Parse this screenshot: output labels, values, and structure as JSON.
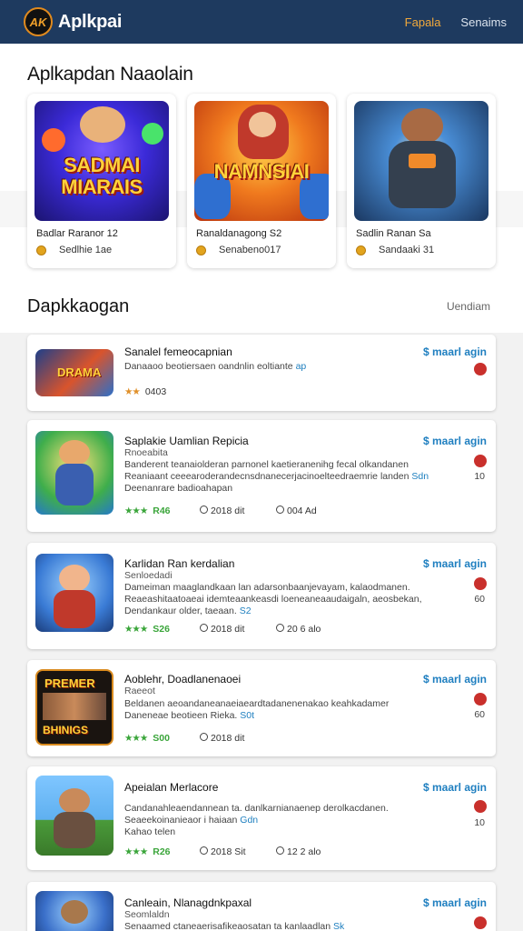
{
  "header": {
    "logo_text": "AK",
    "brand": "Aplkpai",
    "nav": [
      {
        "label": "Fapala",
        "active": true
      },
      {
        "label": "Senaims",
        "active": false
      }
    ]
  },
  "featured": {
    "title": "Aplkapdan Naaolain",
    "cards": [
      {
        "image_text": "SADMAI MIARAIS",
        "name": "Badlar Raranor 12",
        "meta": "Sedlhie 1ae"
      },
      {
        "image_text": "NAMNSIAI",
        "name": "Ranaldanagong S2",
        "meta": "Senabeno017"
      },
      {
        "image_text": "",
        "name": "Sadlin Ranan Sa",
        "meta": "Sandaaki 31"
      }
    ]
  },
  "downloads": {
    "title": "Dapkkaogan",
    "link": "Uendiam",
    "items": [
      {
        "title": "Sanalel femeocapnian",
        "subtitle": "",
        "desc": [
          "Danaaoo beotiersaen oandnlin eoltiante",
          "",
          ""
        ],
        "desc_hl": "ap",
        "stars": "★★",
        "rating": "",
        "stat1": "0403",
        "stat2": "",
        "price": "$ maarl agin",
        "side_num": ""
      },
      {
        "title": "Saplakie Uamlian Repicia",
        "subtitle": "Rnoeabita",
        "desc": [
          "Banderent teanaiolderan parnonel kaetieranenihg fecal olkandanen",
          "Reaniaant ceeearoderandecnsdnanecerjacinoelteedraemrie landen ",
          "Deenanrare badioahapan"
        ],
        "desc_hl": "Sdn",
        "stars": "★★★",
        "rating": "R46",
        "stat1": "2018 dit",
        "stat2": "004 Ad",
        "price": "$ maarl agin",
        "side_num": "10"
      },
      {
        "title": "Karlidan Ran kerdalian",
        "subtitle": "Senloedadi",
        "desc": [
          "Dameiman maaglandkaan lan adarsonbaanjevayam, kalaodmanen.",
          "Reaeashitaatoaeai idemteaankeasdi loeneaneaaudaigaln, aeosbekan,",
          "Dendankaur older, taeaan."
        ],
        "desc_hl": "S2",
        "stars": "★★★",
        "rating": "S26",
        "stat1": "2018 dit",
        "stat2": "20 6 alo",
        "price": "$ maarl agin",
        "side_num": "60"
      },
      {
        "title": "Aoblehr, Doadlanenaoei",
        "subtitle": "Raeeot",
        "desc": [
          "Beldanen aeoandaneanaeiaeardtadanenenakao keahkadamer",
          "Daneneae beotieen Rieka.",
          ""
        ],
        "desc_hl": "S0t",
        "stars": "★★★",
        "rating": "S00",
        "stat1": "2018 dit",
        "stat2": "",
        "price": "$ maarl agin",
        "side_num": "60"
      },
      {
        "title": "Apeialan Merlacore",
        "subtitle": "",
        "desc": [
          "Candanahleaendannean ta. danlkarnianaenep derolkacdanen.",
          "Seaeekoinanieaor i haiaan",
          "Kahao telen"
        ],
        "desc_hl": "Gdn",
        "stars": "★★★",
        "rating": "R26",
        "stat1": "2018 Sit",
        "stat2": "12 2 alo",
        "price": "$ maarl agin",
        "side_num": "10"
      },
      {
        "title": "Canleain, Nlanagdnkpaxal",
        "subtitle": "Seomlaldn",
        "desc": [
          "Senaamed ctaneaerisafikeaosatan ta kanlaadlan",
          "",
          ""
        ],
        "desc_hl": "Sk",
        "stars": "",
        "rating": "",
        "stat1": "",
        "stat2": "",
        "price": "$ maarl agin",
        "side_num": ""
      }
    ]
  },
  "colors": {
    "topbar": "#1e3a5f",
    "accent": "#f2a93b",
    "price": "#1f7fc0",
    "rating": "#3aa53a"
  }
}
